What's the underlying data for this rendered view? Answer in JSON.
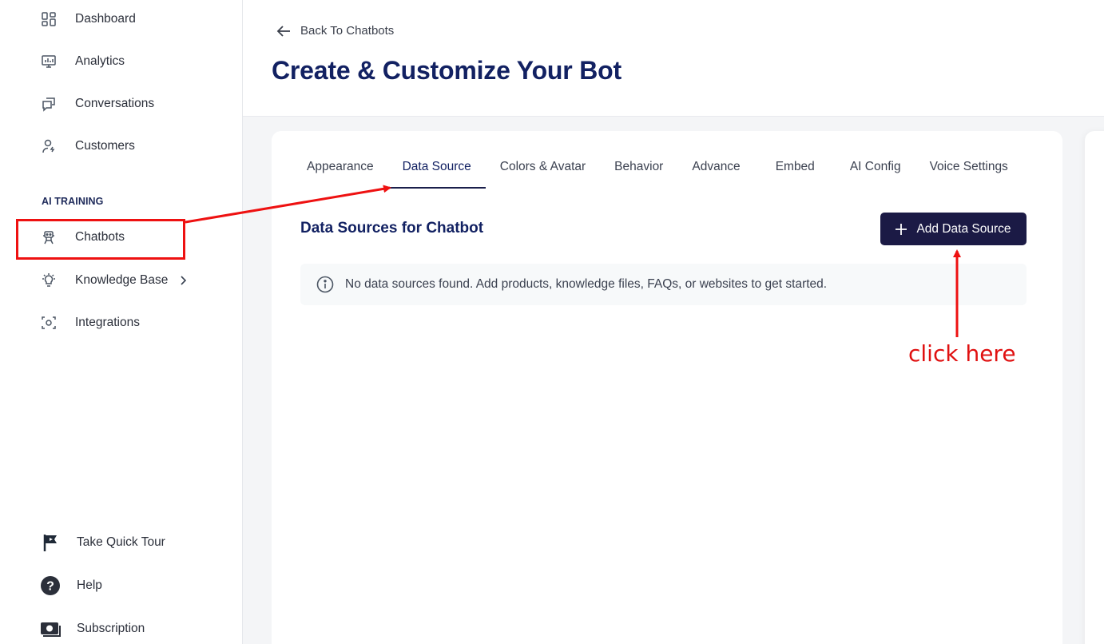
{
  "sidebar": {
    "items": [
      {
        "label": "Dashboard",
        "icon": "dashboard-icon"
      },
      {
        "label": "Analytics",
        "icon": "analytics-icon"
      },
      {
        "label": "Conversations",
        "icon": "conversations-icon"
      },
      {
        "label": "Customers",
        "icon": "customers-icon"
      }
    ],
    "section_label": "AI TRAINING",
    "training_items": [
      {
        "label": "Chatbots",
        "icon": "bot-icon"
      },
      {
        "label": "Knowledge Base",
        "icon": "lightbulb-icon"
      },
      {
        "label": "Integrations",
        "icon": "integrations-icon"
      }
    ],
    "bottom_items": [
      {
        "label": "Take Quick Tour",
        "icon": "flag-icon"
      },
      {
        "label": "Help",
        "icon": "help-icon"
      },
      {
        "label": "Subscription",
        "icon": "money-icon"
      }
    ]
  },
  "header": {
    "back_label": "Back To Chatbots",
    "title": "Create & Customize Your Bot"
  },
  "tabs": [
    {
      "label": "Appearance",
      "active": false
    },
    {
      "label": "Data Source",
      "active": true
    },
    {
      "label": "Colors & Avatar",
      "active": false
    },
    {
      "label": "Behavior",
      "active": false
    },
    {
      "label": "Advance",
      "active": false
    },
    {
      "label": "Embed",
      "active": false
    },
    {
      "label": "AI Config",
      "active": false
    },
    {
      "label": "Voice Settings",
      "active": false
    }
  ],
  "content": {
    "section_title": "Data Sources for Chatbot",
    "add_button_label": "Add Data Source",
    "empty_message": "No data sources found. Add products, knowledge files, FAQs, or websites to get started."
  },
  "annotations": {
    "callout_text": "click here",
    "color": "#ee1111"
  },
  "colors": {
    "primary_dark": "#1b1a45",
    "title_navy": "#122162"
  }
}
